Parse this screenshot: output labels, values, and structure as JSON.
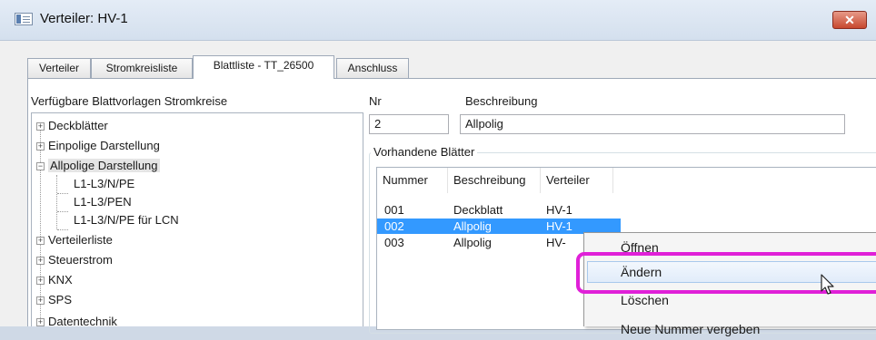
{
  "window": {
    "title": "Verteiler: HV-1",
    "close_glyph": "✕"
  },
  "tabs": [
    {
      "label": "Verteiler",
      "active": false
    },
    {
      "label": "Stromkreisliste",
      "active": false
    },
    {
      "label": "Blattliste - TT_26500",
      "active": true
    },
    {
      "label": "Anschluss",
      "active": false
    }
  ],
  "tree": {
    "label": "Verfügbare Blattvorlagen Stromkreise",
    "items": [
      {
        "label": "Deckblätter",
        "expander": "+"
      },
      {
        "label": "Einpolige Darstellung",
        "expander": "+"
      },
      {
        "label": "Allpolige Darstellung",
        "expander": "−"
      },
      {
        "label": "L1-L3/N/PE"
      },
      {
        "label": "L1-L3/PEN"
      },
      {
        "label": "L1-L3/N/PE für LCN"
      },
      {
        "label": "Verteilerliste",
        "expander": "+"
      },
      {
        "label": "Steuerstrom",
        "expander": "+"
      },
      {
        "label": "KNX",
        "expander": "+"
      },
      {
        "label": "SPS",
        "expander": "+"
      },
      {
        "label": "Datentechnik",
        "expander": "+"
      }
    ]
  },
  "form": {
    "nr_label": "Nr",
    "nr_value": "2",
    "beschreibung_label": "Beschreibung",
    "beschreibung_value": "Allpolig"
  },
  "sheets": {
    "group_label": "Vorhandene Blätter",
    "columns": [
      "Nummer",
      "Beschreibung",
      "Verteiler"
    ],
    "rows": [
      {
        "nummer": "001",
        "beschreibung": "Deckblatt",
        "verteiler": "HV-1",
        "selected": false
      },
      {
        "nummer": "002",
        "beschreibung": "Allpolig",
        "verteiler": "HV-1",
        "selected": true
      },
      {
        "nummer": "003",
        "beschreibung": "Allpolig",
        "verteiler": "HV-",
        "selected": false
      }
    ]
  },
  "context_menu": {
    "items": [
      {
        "label": "Öffnen"
      },
      {
        "label": "Ändern",
        "hovered": true
      },
      {
        "label": "Löschen"
      },
      {
        "label": "Neue Nummer vergeben"
      }
    ]
  },
  "colors": {
    "selection": "#3399ff",
    "highlight_ring": "#e020d8",
    "close_button": "#c7482f"
  }
}
